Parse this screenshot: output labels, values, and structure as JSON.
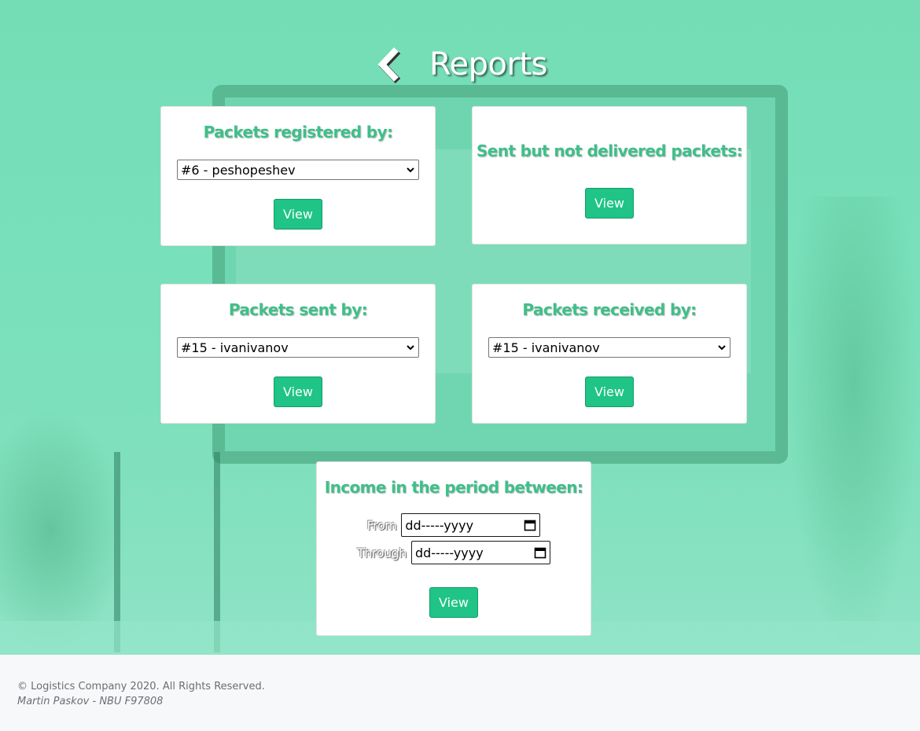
{
  "header": {
    "title": "Reports",
    "back_icon": "chevron-left-icon"
  },
  "cards": {
    "registered": {
      "title": "Packets registered by:",
      "selected": "#6 - peshopeshev",
      "button": "View"
    },
    "not_delivered": {
      "title": "Sent but not delivered packets:",
      "button": "View"
    },
    "sent": {
      "title": "Packets sent by:",
      "selected": "#15 - ivanivanov",
      "button": "View"
    },
    "received": {
      "title": "Packets received by:",
      "selected": "#15 - ivanivanov",
      "button": "View"
    },
    "income": {
      "title": "Income in the period between:",
      "from_label": "From",
      "from_value": "dd-----yyyy",
      "through_label": "Through",
      "through_value": "dd-----yyyy",
      "button": "View"
    }
  },
  "footer": {
    "copyright": "© Logistics Company 2020. All Rights Reserved.",
    "author": "Martin Paskov - NBU F97808"
  },
  "colors": {
    "accent": "#1fc486",
    "title_green": "#3fbf89",
    "hero_bg": "#78e0bb"
  }
}
